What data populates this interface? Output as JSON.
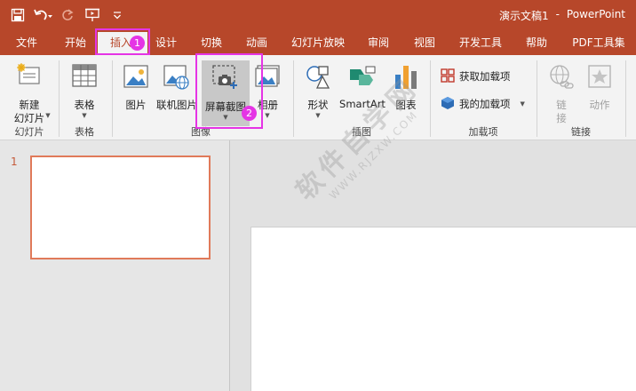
{
  "app": {
    "document_name": "演示文稿1",
    "separator": "-",
    "app_name": "PowerPoint"
  },
  "tabs": [
    "文件",
    "开始",
    "插入",
    "设计",
    "切换",
    "动画",
    "幻灯片放映",
    "审阅",
    "视图",
    "开发工具",
    "帮助",
    "PDF工具集"
  ],
  "active_tab": "插入",
  "ribbon": {
    "new_slide": {
      "line1": "新建",
      "line2": "幻灯片"
    },
    "table": "表格",
    "picture": "图片",
    "online_picture": "联机图片",
    "screenshot": "屏幕截图",
    "album": "相册",
    "shapes": "形状",
    "smartart": "SmartArt",
    "chart": "图表",
    "get_addins": "获取加载项",
    "my_addins": "我的加载项",
    "link": {
      "line1": "链",
      "line2": "接"
    },
    "action": "动作",
    "groups": {
      "slides": "幻灯片",
      "tables": "表格",
      "images": "图像",
      "illustrations": "插图",
      "addins": "加载项",
      "links": "链接"
    }
  },
  "annotations": {
    "step1": "1",
    "step2": "2"
  },
  "thumbnails": {
    "slide_number": "1"
  },
  "watermark": {
    "main": "软件自学网",
    "url": "WWW.RJZXW.COM"
  },
  "colors": {
    "accent": "#b7472a",
    "highlight": "#e534e5",
    "thumb_border": "#e07a5a"
  }
}
